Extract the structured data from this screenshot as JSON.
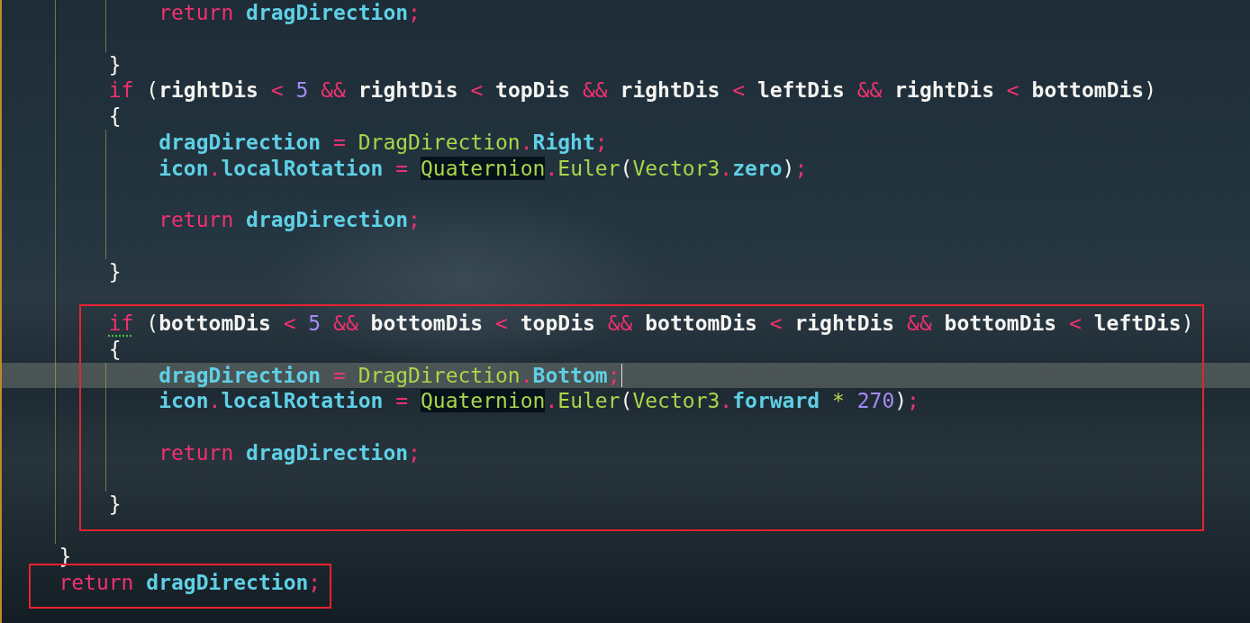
{
  "editor": {
    "lines": [
      {
        "kind": "block",
        "children": [
          {
            "kind": "block",
            "children": [
              {
                "kind": "block",
                "children": [
                  {
                    "kind": "code",
                    "tokens": [
                      {
                        "kind": "kw",
                        "text": "return "
                      },
                      {
                        "kind": "var",
                        "text": "dragDirection"
                      },
                      {
                        "kind": "op",
                        "text": ";"
                      }
                    ]
                  },
                  {
                    "kind": "blank"
                  }
                ]
              },
              {
                "kind": "code",
                "tokens": [
                  {
                    "kind": "punct",
                    "text": "}"
                  }
                ]
              },
              {
                "kind": "code",
                "tokens": [
                  {
                    "kind": "kw",
                    "text": "if"
                  },
                  {
                    "kind": "punct",
                    "text": " ("
                  },
                  {
                    "kind": "id",
                    "text": "rightDis"
                  },
                  {
                    "kind": "op",
                    "text": " < "
                  },
                  {
                    "kind": "num",
                    "text": "5"
                  },
                  {
                    "kind": "op",
                    "text": " && "
                  },
                  {
                    "kind": "id",
                    "text": "rightDis"
                  },
                  {
                    "kind": "op",
                    "text": " < "
                  },
                  {
                    "kind": "id",
                    "text": "topDis"
                  },
                  {
                    "kind": "op",
                    "text": " && "
                  },
                  {
                    "kind": "id",
                    "text": "rightDis"
                  },
                  {
                    "kind": "op",
                    "text": " < "
                  },
                  {
                    "kind": "id",
                    "text": "leftDis"
                  },
                  {
                    "kind": "op",
                    "text": " && "
                  },
                  {
                    "kind": "id",
                    "text": "rightDis"
                  },
                  {
                    "kind": "op",
                    "text": " < "
                  },
                  {
                    "kind": "id",
                    "text": "bottomDis"
                  },
                  {
                    "kind": "punct",
                    "text": ")"
                  }
                ]
              },
              {
                "kind": "code",
                "tokens": [
                  {
                    "kind": "punct",
                    "text": "{"
                  }
                ]
              },
              {
                "kind": "block",
                "children": [
                  {
                    "kind": "code",
                    "tokens": [
                      {
                        "kind": "var",
                        "text": "dragDirection"
                      },
                      {
                        "kind": "op",
                        "text": " = "
                      },
                      {
                        "kind": "type",
                        "text": "DragDirection"
                      },
                      {
                        "kind": "op",
                        "text": "."
                      },
                      {
                        "kind": "member",
                        "text": "Right"
                      },
                      {
                        "kind": "op",
                        "text": ";"
                      }
                    ]
                  },
                  {
                    "kind": "code",
                    "tokens": [
                      {
                        "kind": "var",
                        "text": "icon"
                      },
                      {
                        "kind": "op",
                        "text": "."
                      },
                      {
                        "kind": "var",
                        "text": "localRotation"
                      },
                      {
                        "kind": "op",
                        "text": " = "
                      },
                      {
                        "kind": "type",
                        "text": "Quaternion",
                        "highlighted": true
                      },
                      {
                        "kind": "op",
                        "text": "."
                      },
                      {
                        "kind": "type",
                        "text": "Euler"
                      },
                      {
                        "kind": "punct",
                        "text": "("
                      },
                      {
                        "kind": "type",
                        "text": "Vector3"
                      },
                      {
                        "kind": "op",
                        "text": "."
                      },
                      {
                        "kind": "member",
                        "text": "zero"
                      },
                      {
                        "kind": "punct",
                        "text": ")"
                      },
                      {
                        "kind": "op",
                        "text": ";"
                      }
                    ]
                  },
                  {
                    "kind": "blank"
                  },
                  {
                    "kind": "code",
                    "tokens": [
                      {
                        "kind": "kw",
                        "text": "return "
                      },
                      {
                        "kind": "var",
                        "text": "dragDirection"
                      },
                      {
                        "kind": "op",
                        "text": ";"
                      }
                    ]
                  },
                  {
                    "kind": "blank"
                  }
                ]
              },
              {
                "kind": "code",
                "tokens": [
                  {
                    "kind": "punct",
                    "text": "}"
                  }
                ]
              },
              {
                "kind": "blank"
              },
              {
                "kind": "frame",
                "children": [
                  {
                    "kind": "code",
                    "tokens": [
                      {
                        "kind": "kw",
                        "text": "if",
                        "warning": true
                      },
                      {
                        "kind": "punct",
                        "text": " ("
                      },
                      {
                        "kind": "id",
                        "text": "bottomDis"
                      },
                      {
                        "kind": "op",
                        "text": " < "
                      },
                      {
                        "kind": "num",
                        "text": "5"
                      },
                      {
                        "kind": "op",
                        "text": " && "
                      },
                      {
                        "kind": "id",
                        "text": "bottomDis"
                      },
                      {
                        "kind": "op",
                        "text": " < "
                      },
                      {
                        "kind": "id",
                        "text": "topDis"
                      },
                      {
                        "kind": "op",
                        "text": " && "
                      },
                      {
                        "kind": "id",
                        "text": "bottomDis"
                      },
                      {
                        "kind": "op",
                        "text": " < "
                      },
                      {
                        "kind": "id",
                        "text": "rightDis"
                      },
                      {
                        "kind": "op",
                        "text": " && "
                      },
                      {
                        "kind": "id",
                        "text": "bottomDis"
                      },
                      {
                        "kind": "op",
                        "text": " < "
                      },
                      {
                        "kind": "id",
                        "text": "leftDis"
                      },
                      {
                        "kind": "punct",
                        "text": ")"
                      }
                    ]
                  },
                  {
                    "kind": "code",
                    "tokens": [
                      {
                        "kind": "punct",
                        "text": "{"
                      }
                    ]
                  },
                  {
                    "kind": "block",
                    "children": [
                      {
                        "kind": "code",
                        "current": true,
                        "caret": true,
                        "tokens": [
                          {
                            "kind": "var",
                            "text": "dragDirection"
                          },
                          {
                            "kind": "op",
                            "text": " = "
                          },
                          {
                            "kind": "type",
                            "text": "DragDirection"
                          },
                          {
                            "kind": "op",
                            "text": "."
                          },
                          {
                            "kind": "member",
                            "text": "Bottom"
                          },
                          {
                            "kind": "op",
                            "text": ";"
                          }
                        ]
                      },
                      {
                        "kind": "code",
                        "tokens": [
                          {
                            "kind": "var",
                            "text": "icon"
                          },
                          {
                            "kind": "op",
                            "text": "."
                          },
                          {
                            "kind": "var",
                            "text": "localRotation"
                          },
                          {
                            "kind": "op",
                            "text": " = "
                          },
                          {
                            "kind": "type",
                            "text": "Quaternion",
                            "highlighted": true
                          },
                          {
                            "kind": "op",
                            "text": "."
                          },
                          {
                            "kind": "type",
                            "text": "Euler"
                          },
                          {
                            "kind": "punct",
                            "text": "("
                          },
                          {
                            "kind": "type",
                            "text": "Vector3"
                          },
                          {
                            "kind": "op",
                            "text": "."
                          },
                          {
                            "kind": "member",
                            "text": "forward"
                          },
                          {
                            "kind": "mul",
                            "text": " * "
                          },
                          {
                            "kind": "num",
                            "text": "270"
                          },
                          {
                            "kind": "punct",
                            "text": ")"
                          },
                          {
                            "kind": "op",
                            "text": ";"
                          }
                        ]
                      },
                      {
                        "kind": "blank"
                      },
                      {
                        "kind": "code",
                        "tokens": [
                          {
                            "kind": "kw",
                            "text": "return "
                          },
                          {
                            "kind": "var",
                            "text": "dragDirection"
                          },
                          {
                            "kind": "op",
                            "text": ";"
                          }
                        ]
                      },
                      {
                        "kind": "blank"
                      }
                    ]
                  },
                  {
                    "kind": "code",
                    "tokens": [
                      {
                        "kind": "punct",
                        "text": "}"
                      }
                    ]
                  }
                ]
              },
              {
                "kind": "blank"
              }
            ]
          },
          {
            "kind": "code",
            "tokens": [
              {
                "kind": "punct",
                "text": "}"
              }
            ]
          },
          {
            "kind": "frame",
            "children": [
              {
                "kind": "code",
                "tokens": [
                  {
                    "kind": "kw",
                    "text": "return "
                  },
                  {
                    "kind": "var",
                    "text": "dragDirection"
                  },
                  {
                    "kind": "op",
                    "text": ";"
                  }
                ]
              }
            ]
          },
          {
            "kind": "blank"
          }
        ]
      }
    ]
  }
}
